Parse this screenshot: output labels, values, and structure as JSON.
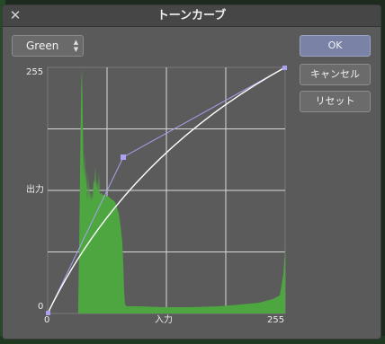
{
  "dialog": {
    "title": "トーンカーブ",
    "close_icon": "close-icon"
  },
  "channel": {
    "selected": "Green",
    "stepper_icon": "up-down-stepper-icon"
  },
  "buttons": {
    "ok": "OK",
    "cancel": "キャンセル",
    "reset": "リセット"
  },
  "axis": {
    "y_max": "255",
    "y_label": "出力",
    "origin": "0",
    "x_min": "0",
    "x_label": "入力",
    "x_max": "255"
  },
  "curve": {
    "control_points": [
      [
        0,
        0
      ],
      [
        82,
        175
      ],
      [
        255,
        255
      ]
    ],
    "color": "#ffffff",
    "handle_color": "#a8a2f0"
  },
  "histogram": {
    "color": "#4ea640"
  }
}
